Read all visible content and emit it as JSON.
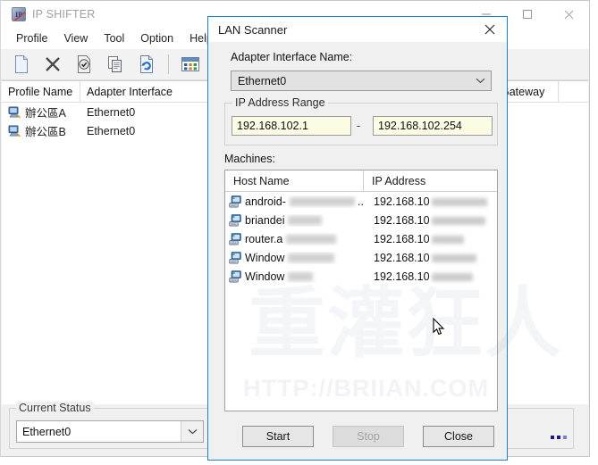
{
  "app": {
    "title": "IP SHIFTER",
    "icon": "app-logo-icon",
    "window_controls": {
      "minimize": "minimize-icon",
      "maximize": "maximize-icon",
      "close": "close-icon"
    },
    "menus": [
      {
        "label": "Profile"
      },
      {
        "label": "View"
      },
      {
        "label": "Tool"
      },
      {
        "label": "Option"
      },
      {
        "label": "Help"
      }
    ],
    "toolbar": [
      {
        "name": "new-profile-icon",
        "glyph": "document"
      },
      {
        "name": "delete-profile-icon",
        "glyph": "x"
      },
      {
        "name": "apply-profile-icon",
        "glyph": "document-check"
      },
      {
        "name": "copy-profile-icon",
        "glyph": "copy"
      },
      {
        "name": "refresh-profile-icon",
        "glyph": "document-refresh"
      },
      {
        "name": "view-mode-icon",
        "glyph": "grid"
      },
      {
        "name": "view-mode-caret-icon",
        "glyph": "caret-down"
      }
    ]
  },
  "profile_list": {
    "columns": [
      "Profile Name",
      "Adapter Interface",
      "Gateway"
    ],
    "rows": [
      {
        "profile_name": "辦公區A",
        "adapter_interface": "Ethernet0"
      },
      {
        "profile_name": "辦公區B",
        "adapter_interface": "Ethernet0"
      }
    ]
  },
  "status_bar": {
    "legend": "Current Status",
    "current_adapter": "Ethernet0",
    "overflow": "..."
  },
  "dialog": {
    "title": "LAN Scanner",
    "close_icon": "close-icon",
    "adapter_label": "Adapter Interface Name:",
    "adapter_value": "Ethernet0",
    "ip_range": {
      "legend": "IP Address Range",
      "from": "192.168.102.1",
      "separator": "-",
      "to": "192.168.102.254"
    },
    "machines_label": "Machines:",
    "machines_columns": [
      "Host Name",
      "IP Address"
    ],
    "machines": [
      {
        "host_prefix": "android-",
        "host_redacted_width": 118,
        "host_suffix": "..",
        "ip_prefix": "192.168.10",
        "ip_redacted_width": 62
      },
      {
        "host_prefix": "briandei",
        "host_redacted_width": 38,
        "host_suffix": "",
        "ip_prefix": "192.168.10",
        "ip_redacted_width": 60
      },
      {
        "host_prefix": "router.a",
        "host_redacted_width": 56,
        "host_suffix": "",
        "ip_prefix": "192.168.10",
        "ip_redacted_width": 36
      },
      {
        "host_prefix": "Window",
        "host_redacted_width": 52,
        "host_suffix": "",
        "ip_prefix": "192.168.10",
        "ip_redacted_width": 50
      },
      {
        "host_prefix": "Window",
        "host_redacted_width": 28,
        "host_suffix": "",
        "ip_prefix": "192.168.10",
        "ip_redacted_width": 46
      }
    ],
    "buttons": {
      "start": "Start",
      "stop": "Stop",
      "close": "Close"
    }
  },
  "watermark": {
    "cjk": "重灌狂人",
    "url": "HTTP://BRIIAN.COM"
  },
  "colors": {
    "dialog_border": "#1a7fd4",
    "window_bg": "#f0f0f0",
    "input_yellow": "#fcfbe4",
    "title_gray": "#a0a0a0"
  }
}
